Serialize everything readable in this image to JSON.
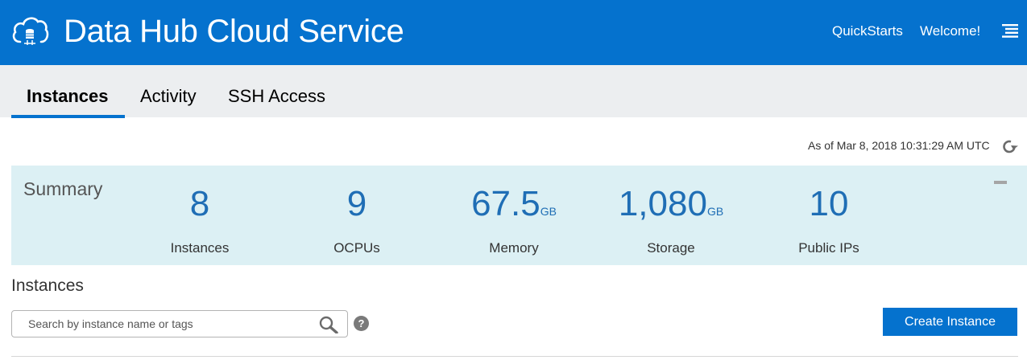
{
  "header": {
    "title": "Data Hub Cloud Service",
    "logo_icon": "cloud-database-icon",
    "links": {
      "quickstarts": "QuickStarts",
      "welcome": "Welcome!"
    },
    "menu_icon": "hamburger-menu-icon",
    "background": "#0572ce"
  },
  "tabs": [
    {
      "label": "Instances",
      "active": true
    },
    {
      "label": "Activity",
      "active": false
    },
    {
      "label": "SSH Access",
      "active": false
    }
  ],
  "status": {
    "timestamp": "As of Mar 8, 2018 10:31:29 AM UTC",
    "refresh_icon": "refresh-icon"
  },
  "summary": {
    "title": "Summary",
    "collapse_icon": "minus-icon",
    "metrics": [
      {
        "value": "8",
        "unit": "",
        "label": "Instances"
      },
      {
        "value": "9",
        "unit": "",
        "label": "OCPUs"
      },
      {
        "value": "67.5",
        "unit": "GB",
        "label": "Memory"
      },
      {
        "value": "1,080",
        "unit": "GB",
        "label": "Storage"
      },
      {
        "value": "10",
        "unit": "",
        "label": "Public IPs"
      }
    ],
    "background": "#dcf0f4",
    "value_color": "#1f6eb5"
  },
  "instances_section": {
    "title": "Instances",
    "search": {
      "placeholder": "Search by instance name or tags",
      "value": ""
    },
    "search_icon": "search-icon",
    "help_icon": "help-icon",
    "create_button": "Create Instance"
  }
}
